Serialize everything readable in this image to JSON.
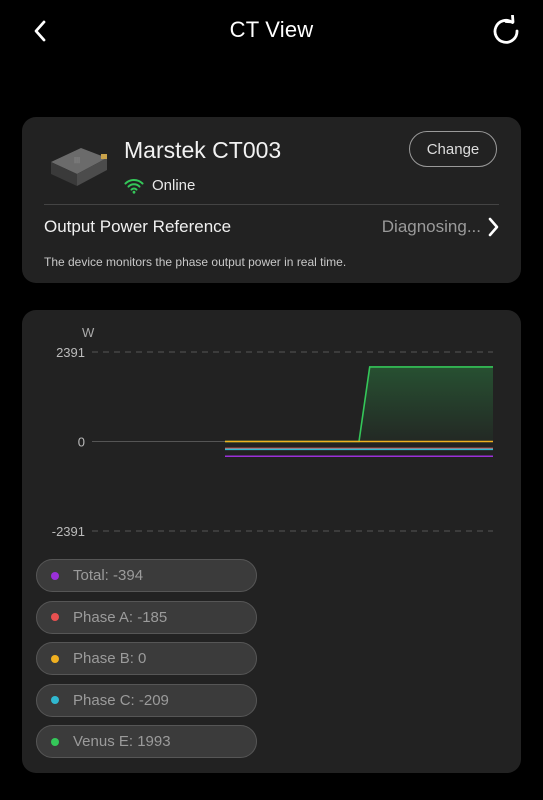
{
  "header": {
    "title": "CT View",
    "back_icon": "chevron-left-icon",
    "refresh_icon": "refresh-icon"
  },
  "device": {
    "name": "Marstek CT003",
    "status": "Online",
    "status_color": "#34c759",
    "change_label": "Change",
    "output_power_label": "Output Power Reference",
    "output_power_value": "Diagnosing...",
    "description": "The device monitors the phase output power in real time."
  },
  "chart_data": {
    "type": "line",
    "ylabel": "W",
    "ylim": [
      -2391,
      2391
    ],
    "y_ticks": [
      "2391",
      "0",
      "-2391"
    ],
    "x_range": [
      0,
      100
    ],
    "series": [
      {
        "name": "Total",
        "value": -394,
        "color": "#9b30d9",
        "points": [
          [
            50,
            -394
          ],
          [
            100,
            -394
          ]
        ]
      },
      {
        "name": "Phase A",
        "value": -185,
        "color": "#e85050",
        "points": [
          [
            50,
            -185
          ],
          [
            100,
            -185
          ]
        ]
      },
      {
        "name": "Phase B",
        "value": 0,
        "color": "#f0b020",
        "points": [
          [
            50,
            0
          ],
          [
            100,
            0
          ]
        ]
      },
      {
        "name": "Phase C",
        "value": -209,
        "color": "#30b8d0",
        "points": [
          [
            50,
            -209
          ],
          [
            100,
            -209
          ]
        ]
      },
      {
        "name": "Venus E",
        "value": 1993,
        "color": "#34c759",
        "points": [
          [
            50,
            0
          ],
          [
            75,
            0
          ],
          [
            77,
            1993
          ],
          [
            100,
            1993
          ]
        ]
      }
    ]
  },
  "legend": [
    {
      "label": "Total: -394",
      "color": "#9b30d9"
    },
    {
      "label": "Phase A: -185",
      "color": "#e85050"
    },
    {
      "label": "Phase B: 0",
      "color": "#f0b020"
    },
    {
      "label": "Phase C: -209",
      "color": "#30b8d0"
    },
    {
      "label": "Venus E: 1993",
      "color": "#34c759"
    }
  ]
}
